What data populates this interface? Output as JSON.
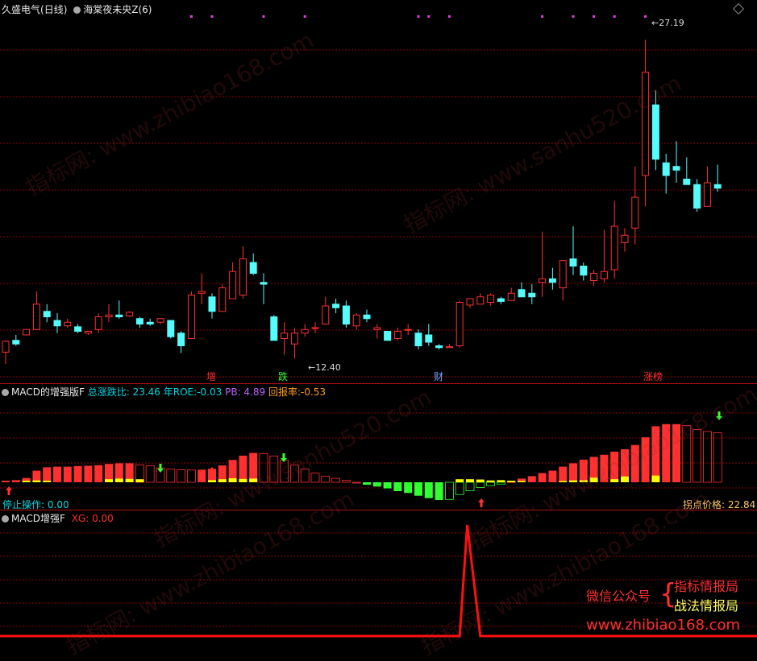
{
  "header": {
    "stock_name": "久盛电气",
    "period": "(日线)",
    "indicator": "海棠夜未央Z(6)"
  },
  "price_labels": {
    "high": "27.19",
    "low": "12.40"
  },
  "event_badges": [
    {
      "label": "增",
      "color": "#ff3030"
    },
    {
      "label": "跌",
      "color": "#30ff30"
    },
    {
      "label": "财",
      "color": "#6fa8ff"
    },
    {
      "label": "涨榜",
      "color": "#ff3030"
    }
  ],
  "macd_panel": {
    "title": "MACD的增强版F",
    "stats": [
      {
        "label": "总涨跌比:",
        "value": "23.46",
        "color": "#00d8e0"
      },
      {
        "label": "年ROE:",
        "value": "-0.03",
        "color": "#00d8e0"
      },
      {
        "label": "PB:",
        "value": "4.89",
        "color": "#c060ff"
      },
      {
        "label": "回报率:",
        "value": "-0.53",
        "color": "#ff9a20"
      }
    ],
    "stop_label": "停止操作:",
    "stop_value": "0.00",
    "turn_label": "拐点价格:",
    "turn_value": "22.84"
  },
  "macd2_panel": {
    "title": "MACD增强F",
    "xg_label": "XG:",
    "xg_value": "0.00"
  },
  "ad": {
    "wechat": "微信公众号",
    "brand1": "指标情报局",
    "brand2": "战法情报局",
    "url": "www.zhibiao168.com"
  },
  "watermarks": [
    "指标网: www.zhibiao168.com",
    "指标网: www.sanhu520.com"
  ],
  "colors": {
    "up": "#ff3030",
    "down": "#54fcfc",
    "grid": "#8b0000",
    "yellow": "#ffff00",
    "green": "#30ff30"
  },
  "chart_data": {
    "type": "candlestick",
    "candles": [
      [
        9.95,
        10.6,
        9.3,
        10.55
      ],
      [
        10.6,
        10.9,
        10.3,
        10.4
      ],
      [
        10.9,
        11.2,
        10.9,
        11.2
      ],
      [
        11.2,
        13.3,
        11.2,
        12.6
      ],
      [
        12.2,
        12.6,
        11.6,
        11.9
      ],
      [
        11.7,
        12.1,
        11.0,
        11.4
      ],
      [
        11.4,
        11.8,
        11.3,
        11.6
      ],
      [
        11.35,
        11.5,
        11.0,
        11.1
      ],
      [
        11.0,
        11.0,
        10.9,
        11.1
      ],
      [
        11.2,
        12.1,
        11.0,
        11.9
      ],
      [
        11.9,
        12.6,
        11.6,
        12.0
      ],
      [
        12.0,
        12.8,
        11.8,
        11.9
      ],
      [
        11.95,
        12.2,
        11.9,
        12.15
      ],
      [
        11.8,
        11.9,
        11.3,
        11.5
      ],
      [
        11.6,
        11.8,
        11.4,
        11.5
      ],
      [
        11.6,
        11.8,
        11.5,
        11.8
      ],
      [
        11.7,
        11.7,
        10.7,
        10.8
      ],
      [
        11.0,
        11.1,
        9.9,
        10.3
      ],
      [
        10.7,
        13.3,
        10.7,
        13.1
      ],
      [
        13.2,
        14.3,
        12.6,
        13.3
      ],
      [
        13.0,
        13.2,
        11.8,
        12.2
      ],
      [
        12.2,
        13.7,
        12.2,
        13.5
      ],
      [
        12.9,
        14.9,
        12.9,
        14.4
      ],
      [
        13.1,
        15.8,
        12.9,
        15.1
      ],
      [
        14.9,
        15.4,
        14.2,
        14.3
      ],
      [
        13.8,
        14.3,
        12.6,
        13.7
      ],
      [
        11.9,
        12.0,
        10.6,
        10.6
      ],
      [
        10.7,
        11.6,
        9.8,
        11.0
      ],
      [
        10.4,
        11.3,
        9.6,
        11.0
      ],
      [
        11.0,
        11.5,
        10.8,
        11.2
      ],
      [
        11.3,
        11.6,
        11.0,
        11.3
      ],
      [
        11.5,
        13.0,
        11.5,
        12.5
      ],
      [
        12.6,
        12.9,
        12.1,
        12.4
      ],
      [
        12.5,
        12.8,
        11.3,
        11.5
      ],
      [
        11.4,
        12.1,
        11.2,
        12.0
      ],
      [
        12.0,
        12.3,
        11.6,
        11.8
      ],
      [
        11.2,
        11.5,
        10.7,
        11.3
      ],
      [
        11.1,
        11.1,
        10.6,
        10.6
      ],
      [
        10.7,
        11.3,
        10.6,
        11.1
      ],
      [
        11.2,
        11.5,
        10.9,
        11.2
      ],
      [
        11.0,
        11.2,
        10.1,
        10.3
      ],
      [
        10.9,
        11.5,
        10.3,
        10.5
      ],
      [
        10.3,
        10.4,
        10.1,
        10.2
      ],
      [
        10.2,
        10.4,
        10.2,
        10.25
      ],
      [
        10.3,
        12.8,
        10.2,
        12.7
      ],
      [
        12.55,
        12.7,
        12.4,
        12.9
      ],
      [
        12.6,
        13.2,
        12.6,
        13.0
      ],
      [
        12.7,
        13.2,
        12.5,
        13.1
      ],
      [
        12.9,
        13.0,
        12.6,
        12.75
      ],
      [
        12.8,
        13.5,
        12.8,
        13.2
      ],
      [
        13.4,
        13.8,
        13.2,
        13.0
      ],
      [
        13.2,
        13.7,
        12.6,
        13.0
      ],
      [
        13.8,
        16.6,
        13.0,
        14.0
      ],
      [
        14.0,
        14.6,
        13.4,
        13.8
      ],
      [
        13.5,
        15.0,
        12.8,
        15.0
      ],
      [
        15.1,
        16.9,
        14.2,
        14.7
      ],
      [
        14.7,
        14.9,
        13.9,
        14.2
      ],
      [
        13.9,
        14.5,
        13.6,
        14.3
      ],
      [
        14.0,
        16.7,
        13.8,
        14.4
      ],
      [
        14.5,
        18.3,
        14.0,
        16.9
      ],
      [
        16.0,
        16.8,
        15.5,
        16.4
      ],
      [
        16.8,
        20.2,
        15.9,
        18.5
      ],
      [
        19.7,
        27.19,
        18.0,
        25.4
      ],
      [
        23.6,
        24.4,
        20.0,
        20.6
      ],
      [
        20.4,
        20.9,
        18.7,
        19.7
      ],
      [
        20.2,
        21.6,
        19.3,
        20.0
      ],
      [
        19.5,
        20.7,
        19.2,
        19.2
      ],
      [
        19.2,
        19.5,
        17.7,
        17.9
      ],
      [
        18.0,
        20.2,
        18.0,
        19.3
      ],
      [
        19.2,
        20.3,
        18.8,
        19.0
      ]
    ],
    "y_range": [
      8.5,
      28.5
    ],
    "macd_hist": [
      0.05,
      0.07,
      0.14,
      0.38,
      0.49,
      0.51,
      0.51,
      0.53,
      0.54,
      0.56,
      0.6,
      0.62,
      0.62,
      0.57,
      0.54,
      0.47,
      0.43,
      0.41,
      0.4,
      0.41,
      0.44,
      0.55,
      0.73,
      0.87,
      0.96,
      0.94,
      0.86,
      0.72,
      0.56,
      0.43,
      0.3,
      0.2,
      0.13,
      0.06,
      0.0,
      -0.08,
      -0.14,
      -0.2,
      -0.29,
      -0.35,
      -0.44,
      -0.52,
      -0.58,
      -0.56,
      -0.4,
      -0.28,
      -0.17,
      -0.11,
      -0.06,
      0.02,
      0.12,
      0.2,
      0.3,
      0.38,
      0.51,
      0.62,
      0.74,
      0.83,
      0.9,
      1.0,
      1.08,
      1.22,
      1.47,
      1.83,
      1.9,
      1.9,
      1.85,
      1.72,
      1.66,
      1.62
    ],
    "macd_yellow": [
      0,
      0,
      0.05,
      0.06,
      0.05,
      0,
      0,
      0,
      0,
      0,
      0.1,
      0.12,
      0.11,
      0.1,
      0,
      0,
      0,
      0,
      0,
      0,
      0.07,
      0.1,
      0.13,
      0.11,
      0.12,
      0,
      0,
      0,
      0,
      0,
      0,
      0,
      0,
      0,
      0,
      0,
      0,
      0,
      0,
      0,
      0,
      0,
      0,
      0,
      0.1,
      0.1,
      0.09,
      0.06,
      0.07,
      0.05,
      0.04,
      0,
      0,
      0,
      0.04,
      0.06,
      0.07,
      0.15,
      0,
      0.1,
      0.19,
      0,
      0,
      0.22,
      0,
      0,
      0,
      0,
      0,
      0
    ],
    "xg_spike_index": 45
  }
}
